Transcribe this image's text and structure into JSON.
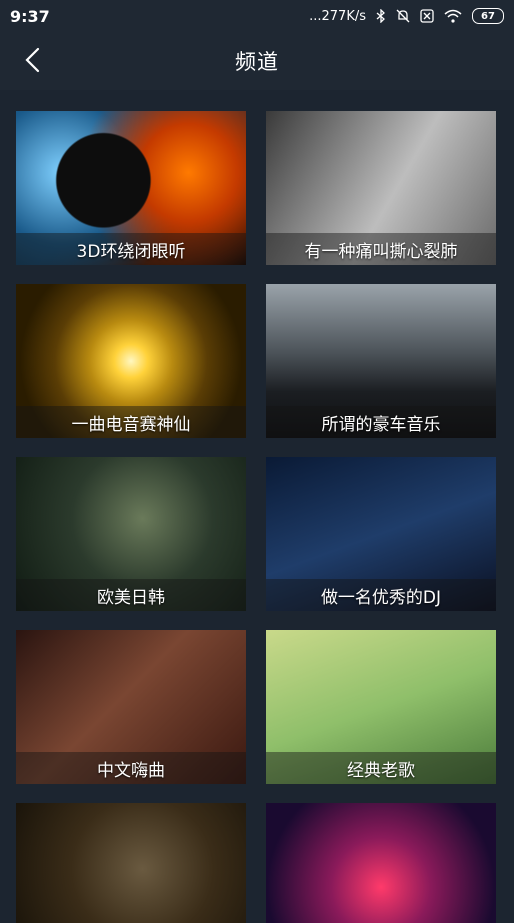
{
  "status_bar": {
    "time": "9:37",
    "network_speed": "...277K/s",
    "battery": "67",
    "icons": [
      "bluetooth-icon",
      "mute-bell-icon",
      "sim-x-icon",
      "wifi-icon",
      "battery-icon"
    ]
  },
  "header": {
    "title": "频道",
    "back_icon": "back-chevron-icon"
  },
  "channels": [
    {
      "label": "3D环绕闭眼听"
    },
    {
      "label": "有一种痛叫撕心裂肺"
    },
    {
      "label": "一曲电音赛神仙"
    },
    {
      "label": "所谓的豪车音乐"
    },
    {
      "label": "欧美日韩"
    },
    {
      "label": "做一名优秀的DJ"
    },
    {
      "label": "中文嗨曲"
    },
    {
      "label": "经典老歌"
    },
    {
      "label": ""
    },
    {
      "label": ""
    }
  ],
  "colors": {
    "background": "#1c2530",
    "header": "#1f2833",
    "text": "#ffffff"
  }
}
